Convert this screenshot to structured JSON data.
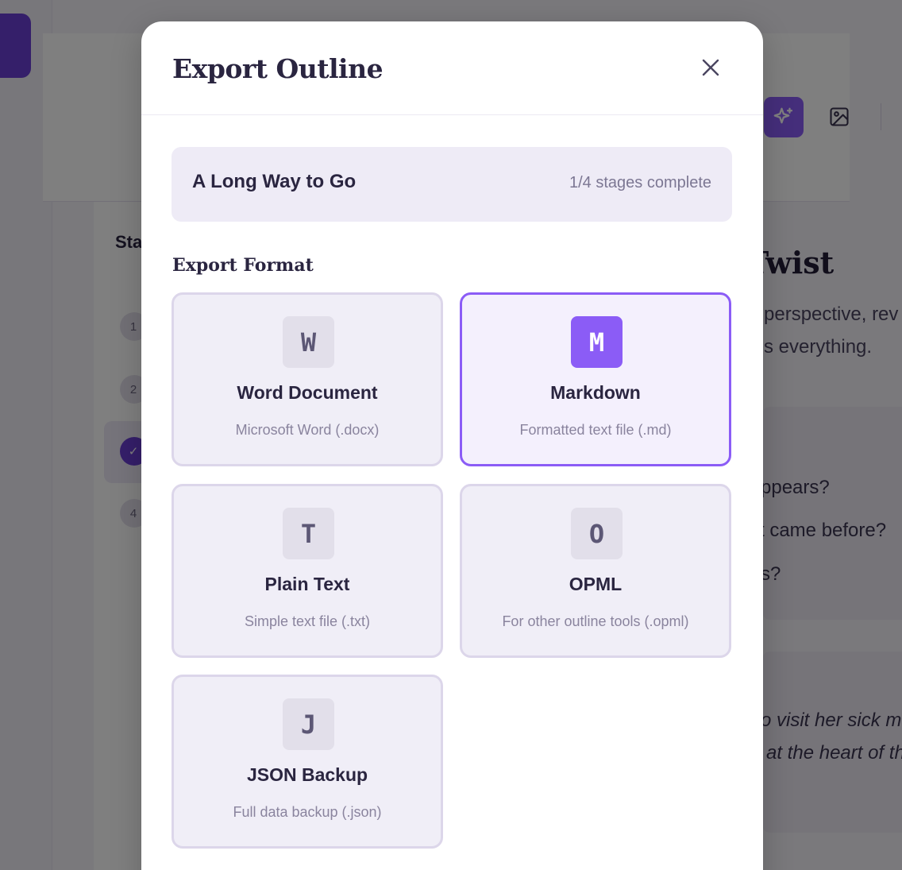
{
  "background": {
    "stages_title": "Sta",
    "stages": [
      {
        "label": "1",
        "state": "pending"
      },
      {
        "label": "2",
        "state": "pending"
      },
      {
        "label": "✓",
        "state": "complete"
      },
      {
        "label": "4",
        "state": "pending"
      }
    ],
    "content_title": "Twist",
    "content_desc_lines": [
      "perspective, rev",
      "s everything."
    ],
    "question_lines": [
      "ppears?",
      "t came before?",
      "s?"
    ],
    "italic_lines": [
      "o visit her sick m",
      "at the heart of th"
    ],
    "toolbar_icons": [
      "sparkle-icon",
      "image-icon"
    ],
    "accent_color": "#6b3fd4"
  },
  "modal": {
    "title": "Export Outline",
    "close_icon": "close-icon",
    "project": {
      "name": "A Long Way to Go",
      "progress": "1/4 stages complete"
    },
    "section_label": "Export Format",
    "formats": [
      {
        "badge": "W",
        "name": "Word Document",
        "desc": "Microsoft Word (.docx)",
        "selected": false
      },
      {
        "badge": "M",
        "name": "Markdown",
        "desc": "Formatted text file (.md)",
        "selected": true
      },
      {
        "badge": "T",
        "name": "Plain Text",
        "desc": "Simple text file (.txt)",
        "selected": false
      },
      {
        "badge": "O",
        "name": "OPML",
        "desc": "For other outline tools (.opml)",
        "selected": false
      },
      {
        "badge": "J",
        "name": "JSON Backup",
        "desc": "Full data backup (.json)",
        "selected": false
      }
    ],
    "selected_color": "#8b5cf6"
  }
}
